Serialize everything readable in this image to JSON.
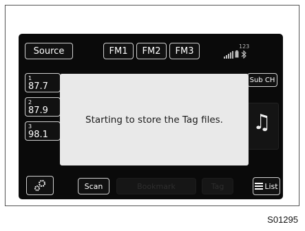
{
  "header": {
    "source_label": "Source",
    "bands": [
      {
        "label": "FM1"
      },
      {
        "label": "FM2"
      },
      {
        "label": "FM3"
      }
    ],
    "status_number": "123"
  },
  "presets": [
    {
      "num": "1",
      "freq": "87.7"
    },
    {
      "num": "2",
      "freq": "87.9"
    },
    {
      "num": "3",
      "freq": "98.1"
    }
  ],
  "sub_ch_label": "Sub CH",
  "dialog": {
    "message": "Starting to store the Tag files."
  },
  "footer": {
    "scan_label": "Scan",
    "bookmark_label": "Bookmark",
    "tag_label": "Tag",
    "list_label": "List"
  },
  "caption": "S01295",
  "icons": {
    "settings": "gear-icon",
    "list": "list-icon",
    "music": "music-note-icon",
    "signal": "signal-icon",
    "battery": "battery-icon",
    "bluetooth": "bluetooth-icon"
  },
  "colors": {
    "screen_bg": "#0a0a0a",
    "dialog_bg": "#e9e9e9",
    "text_light": "#ffffff"
  }
}
